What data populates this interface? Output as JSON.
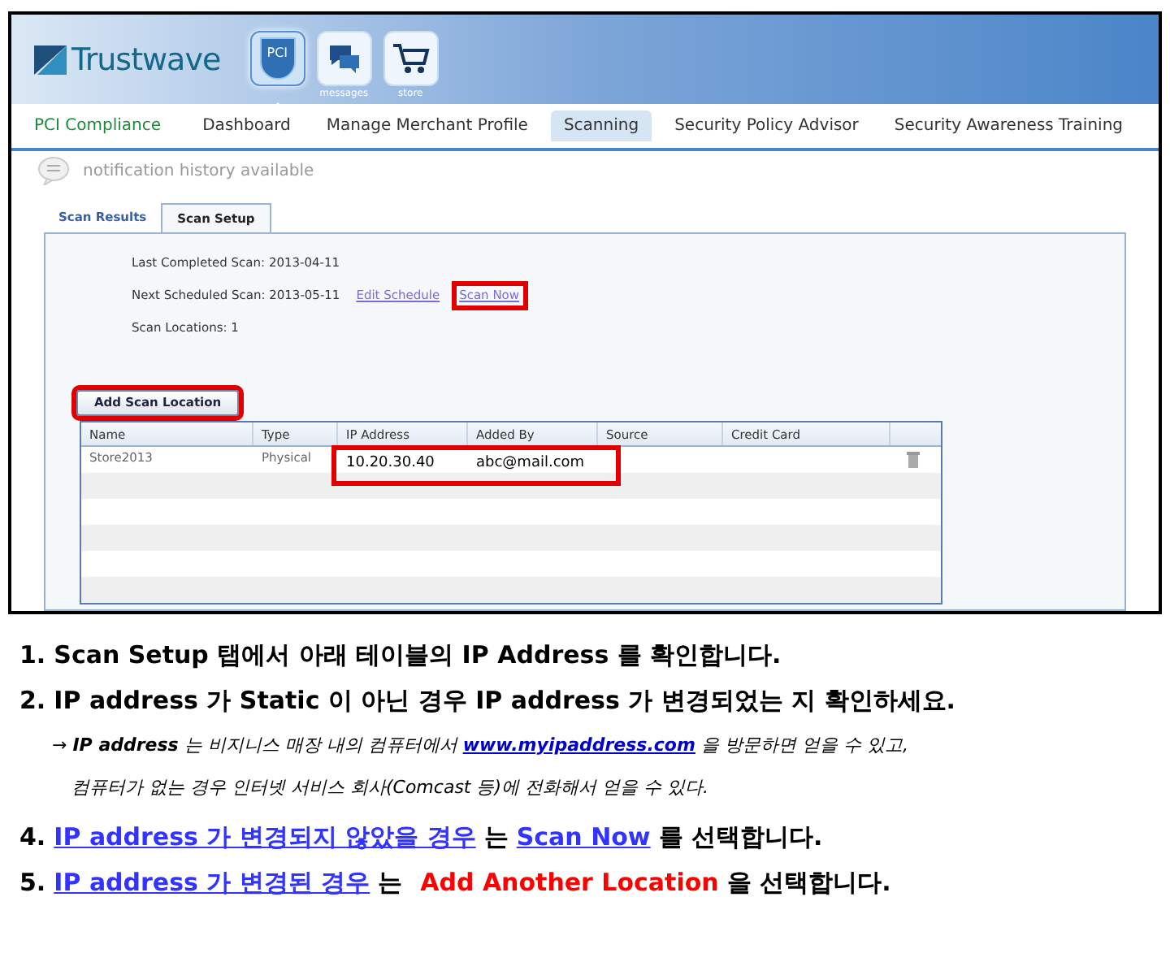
{
  "header": {
    "logo": "Trustwave",
    "app_icons": [
      {
        "kind": "shield",
        "badge": "PCI",
        "selected": true
      },
      {
        "kind": "chat",
        "label": "messages",
        "selected": false
      },
      {
        "kind": "cart",
        "label": "store",
        "selected": false
      }
    ]
  },
  "nav": {
    "brand": "PCI Compliance",
    "items": [
      {
        "label": "Dashboard",
        "selected": false
      },
      {
        "label": "Manage Merchant Profile",
        "selected": false
      },
      {
        "label": "Scanning",
        "selected": true
      },
      {
        "label": "Security Policy Advisor",
        "selected": false
      },
      {
        "label": "Security Awareness Training",
        "selected": false
      }
    ]
  },
  "notification": "notification history available",
  "tabs": [
    {
      "label": "Scan Results",
      "selected": false
    },
    {
      "label": "Scan Setup",
      "selected": true
    }
  ],
  "scan_info": {
    "last_completed": "Last Completed Scan: 2013-04-11",
    "next_scheduled": "Next Scheduled Scan: 2013-05-11",
    "edit_schedule": "Edit Schedule",
    "scan_now": {
      "label": "Scan Now",
      "highlighted": true
    },
    "locations": "Scan Locations: 1"
  },
  "add_button": {
    "label": "Add Scan Location",
    "highlighted": true
  },
  "table": {
    "columns": [
      "Name",
      "Type",
      "IP Address",
      "Added By",
      "Source",
      "Credit Card"
    ],
    "rows": [
      {
        "cells": [
          "Store2013",
          "Physical",
          "10.20.30.40",
          "abc@mail.com",
          "",
          ""
        ],
        "highlighted": true
      }
    ]
  },
  "instructions": [
    {
      "number": "1.",
      "segments": [
        {
          "kind": "plain",
          "text": "Scan Setup 탭에서 아래 테이블의 IP Address 를 확인합니다."
        }
      ]
    },
    {
      "number": "2.",
      "segments": [
        {
          "kind": "plain",
          "text": "IP address 가 Static 이 아닌 경우 IP address 가 변경되었는 지 확인하세요."
        }
      ],
      "note": {
        "arrow": "→",
        "before": "**IP address** 는 비지니스 매장 내의 컴퓨터에서",
        "link": "www.myipaddress.com",
        "after": "을  방문하면 얻을 수 있고,",
        "continuation": "컴퓨터가 없는 경우 인터넷 서비스 회사(Comcast  등)에 전화해서 얻을 수 있다."
      }
    },
    {
      "number": "4.",
      "segments": [
        {
          "kind": "link",
          "text": "IP address 가 변경되지 않았을 경우"
        },
        {
          "kind": "plain",
          "text": "는"
        },
        {
          "kind": "link",
          "text": "Scan Now"
        },
        {
          "kind": "plain",
          "text": "를 선택합니다."
        }
      ]
    },
    {
      "number": "5.",
      "segments": [
        {
          "kind": "link",
          "text": "IP address 가 변경된 경우"
        },
        {
          "kind": "plain",
          "text": "는"
        },
        {
          "kind": "red",
          "text": "Add Another Location"
        },
        {
          "kind": "plain",
          "text": "을 선택합니다."
        }
      ]
    }
  ]
}
